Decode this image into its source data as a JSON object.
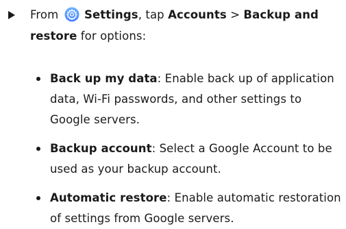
{
  "step": {
    "prefix": "From",
    "settings": "Settings",
    "tap": ", tap",
    "accounts": "Accounts",
    "separator": ">",
    "backup_restore": "Backup and restore",
    "suffix": "for options:"
  },
  "options": [
    {
      "term": "Back up my data",
      "desc": ": Enable back up of application data, Wi-Fi passwords, and other settings to Google servers."
    },
    {
      "term": "Backup account",
      "desc": ": Select a Google Account to be used as your backup account."
    },
    {
      "term": "Automatic restore",
      "desc": ": Enable automatic restoration of settings from Google servers."
    }
  ],
  "colors": {
    "text": "#1a1a1a",
    "settings_icon_start": "#6fb3ff",
    "settings_icon_end": "#3d7dff"
  },
  "icons": {
    "settings": "gear-icon",
    "marker": "triangle-right-icon",
    "bullet": "bullet-dot-icon"
  }
}
